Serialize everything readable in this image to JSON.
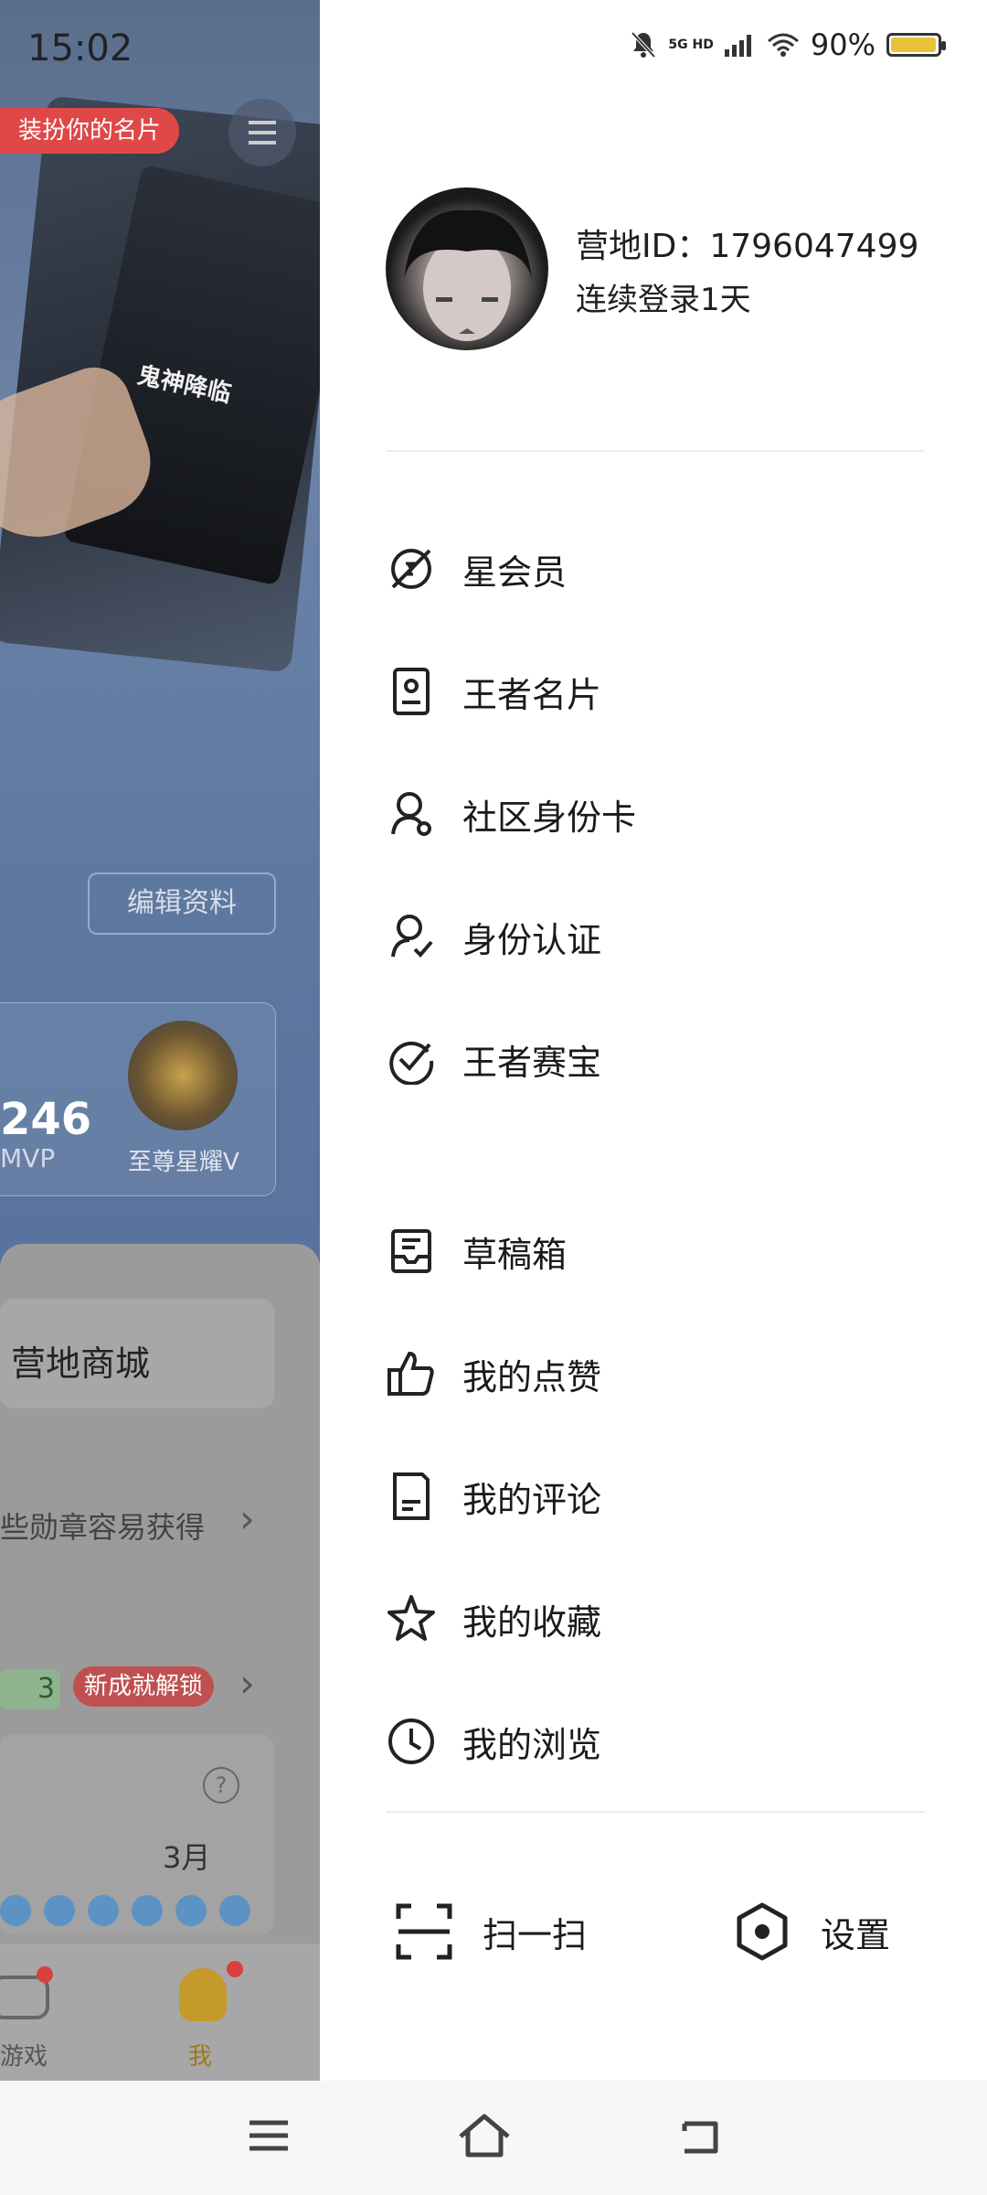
{
  "background_app": {
    "time": "15:02",
    "tag_text": "装扮你的名片",
    "card_title": "鬼神降临",
    "edit_button": "编辑资料",
    "stat_number": "246",
    "stat_label": "MVP",
    "rank_label": "至尊星耀V",
    "shop_label": "营地商城",
    "badge_hint": "些勋章容易获得",
    "green_count": "3",
    "new_badge": "新成就解锁",
    "month": "3月",
    "tabs": [
      "游戏",
      "我"
    ]
  },
  "status_bar": {
    "network": "5G HD",
    "wifi_icon": "wifi-icon",
    "battery": "90%"
  },
  "profile": {
    "camp_id": "营地ID：1796047499",
    "login_streak": "连续登录1天"
  },
  "menu_group1": [
    {
      "label": "星会员",
      "icon": "star-member-icon"
    },
    {
      "label": "王者名片",
      "icon": "name-card-icon"
    },
    {
      "label": "社区身份卡",
      "icon": "community-id-icon"
    },
    {
      "label": "身份认证",
      "icon": "verify-identity-icon"
    },
    {
      "label": "王者赛宝",
      "icon": "match-check-icon"
    }
  ],
  "menu_group2": [
    {
      "label": "草稿箱",
      "icon": "drafts-icon"
    },
    {
      "label": "我的点赞",
      "icon": "thumbs-up-icon"
    },
    {
      "label": "我的评论",
      "icon": "comment-doc-icon"
    },
    {
      "label": "我的收藏",
      "icon": "star-outline-icon"
    },
    {
      "label": "我的浏览",
      "icon": "clock-icon"
    }
  ],
  "bottom_actions": {
    "scan": "扫一扫",
    "settings": "设置"
  }
}
